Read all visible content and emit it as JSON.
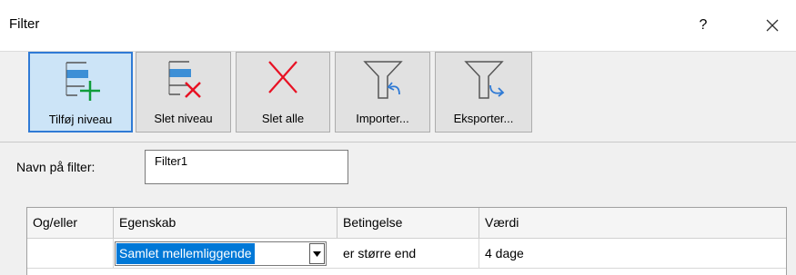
{
  "window": {
    "title": "Filter",
    "help_label": "?"
  },
  "toolbar": {
    "buttons": [
      {
        "id": "add-level",
        "label": "Tilføj niveau",
        "icon": "add-level-icon",
        "active": true
      },
      {
        "id": "delete-level",
        "label": "Slet niveau",
        "icon": "delete-level-icon",
        "active": false
      },
      {
        "id": "delete-all",
        "label": "Slet alle",
        "icon": "delete-all-icon",
        "active": false
      },
      {
        "id": "import",
        "label": "Importer...",
        "icon": "filter-import-icon",
        "active": false
      },
      {
        "id": "export",
        "label": "Eksporter...",
        "icon": "filter-export-icon",
        "active": false
      }
    ]
  },
  "filter_name": {
    "label": "Navn på filter:",
    "value": "Filter1"
  },
  "grid": {
    "columns": [
      "Og/eller",
      "Egenskab",
      "Betingelse",
      "Værdi"
    ],
    "rows": [
      {
        "and_or": "",
        "property": "Samlet mellemliggende",
        "condition": "er større end",
        "value": "4 dage"
      }
    ]
  },
  "colors": {
    "accent": "#0078d7",
    "active_border": "#2f7ad5",
    "green": "#0f9d3a",
    "red": "#e81123",
    "blue_bar": "#3d8fd6"
  }
}
